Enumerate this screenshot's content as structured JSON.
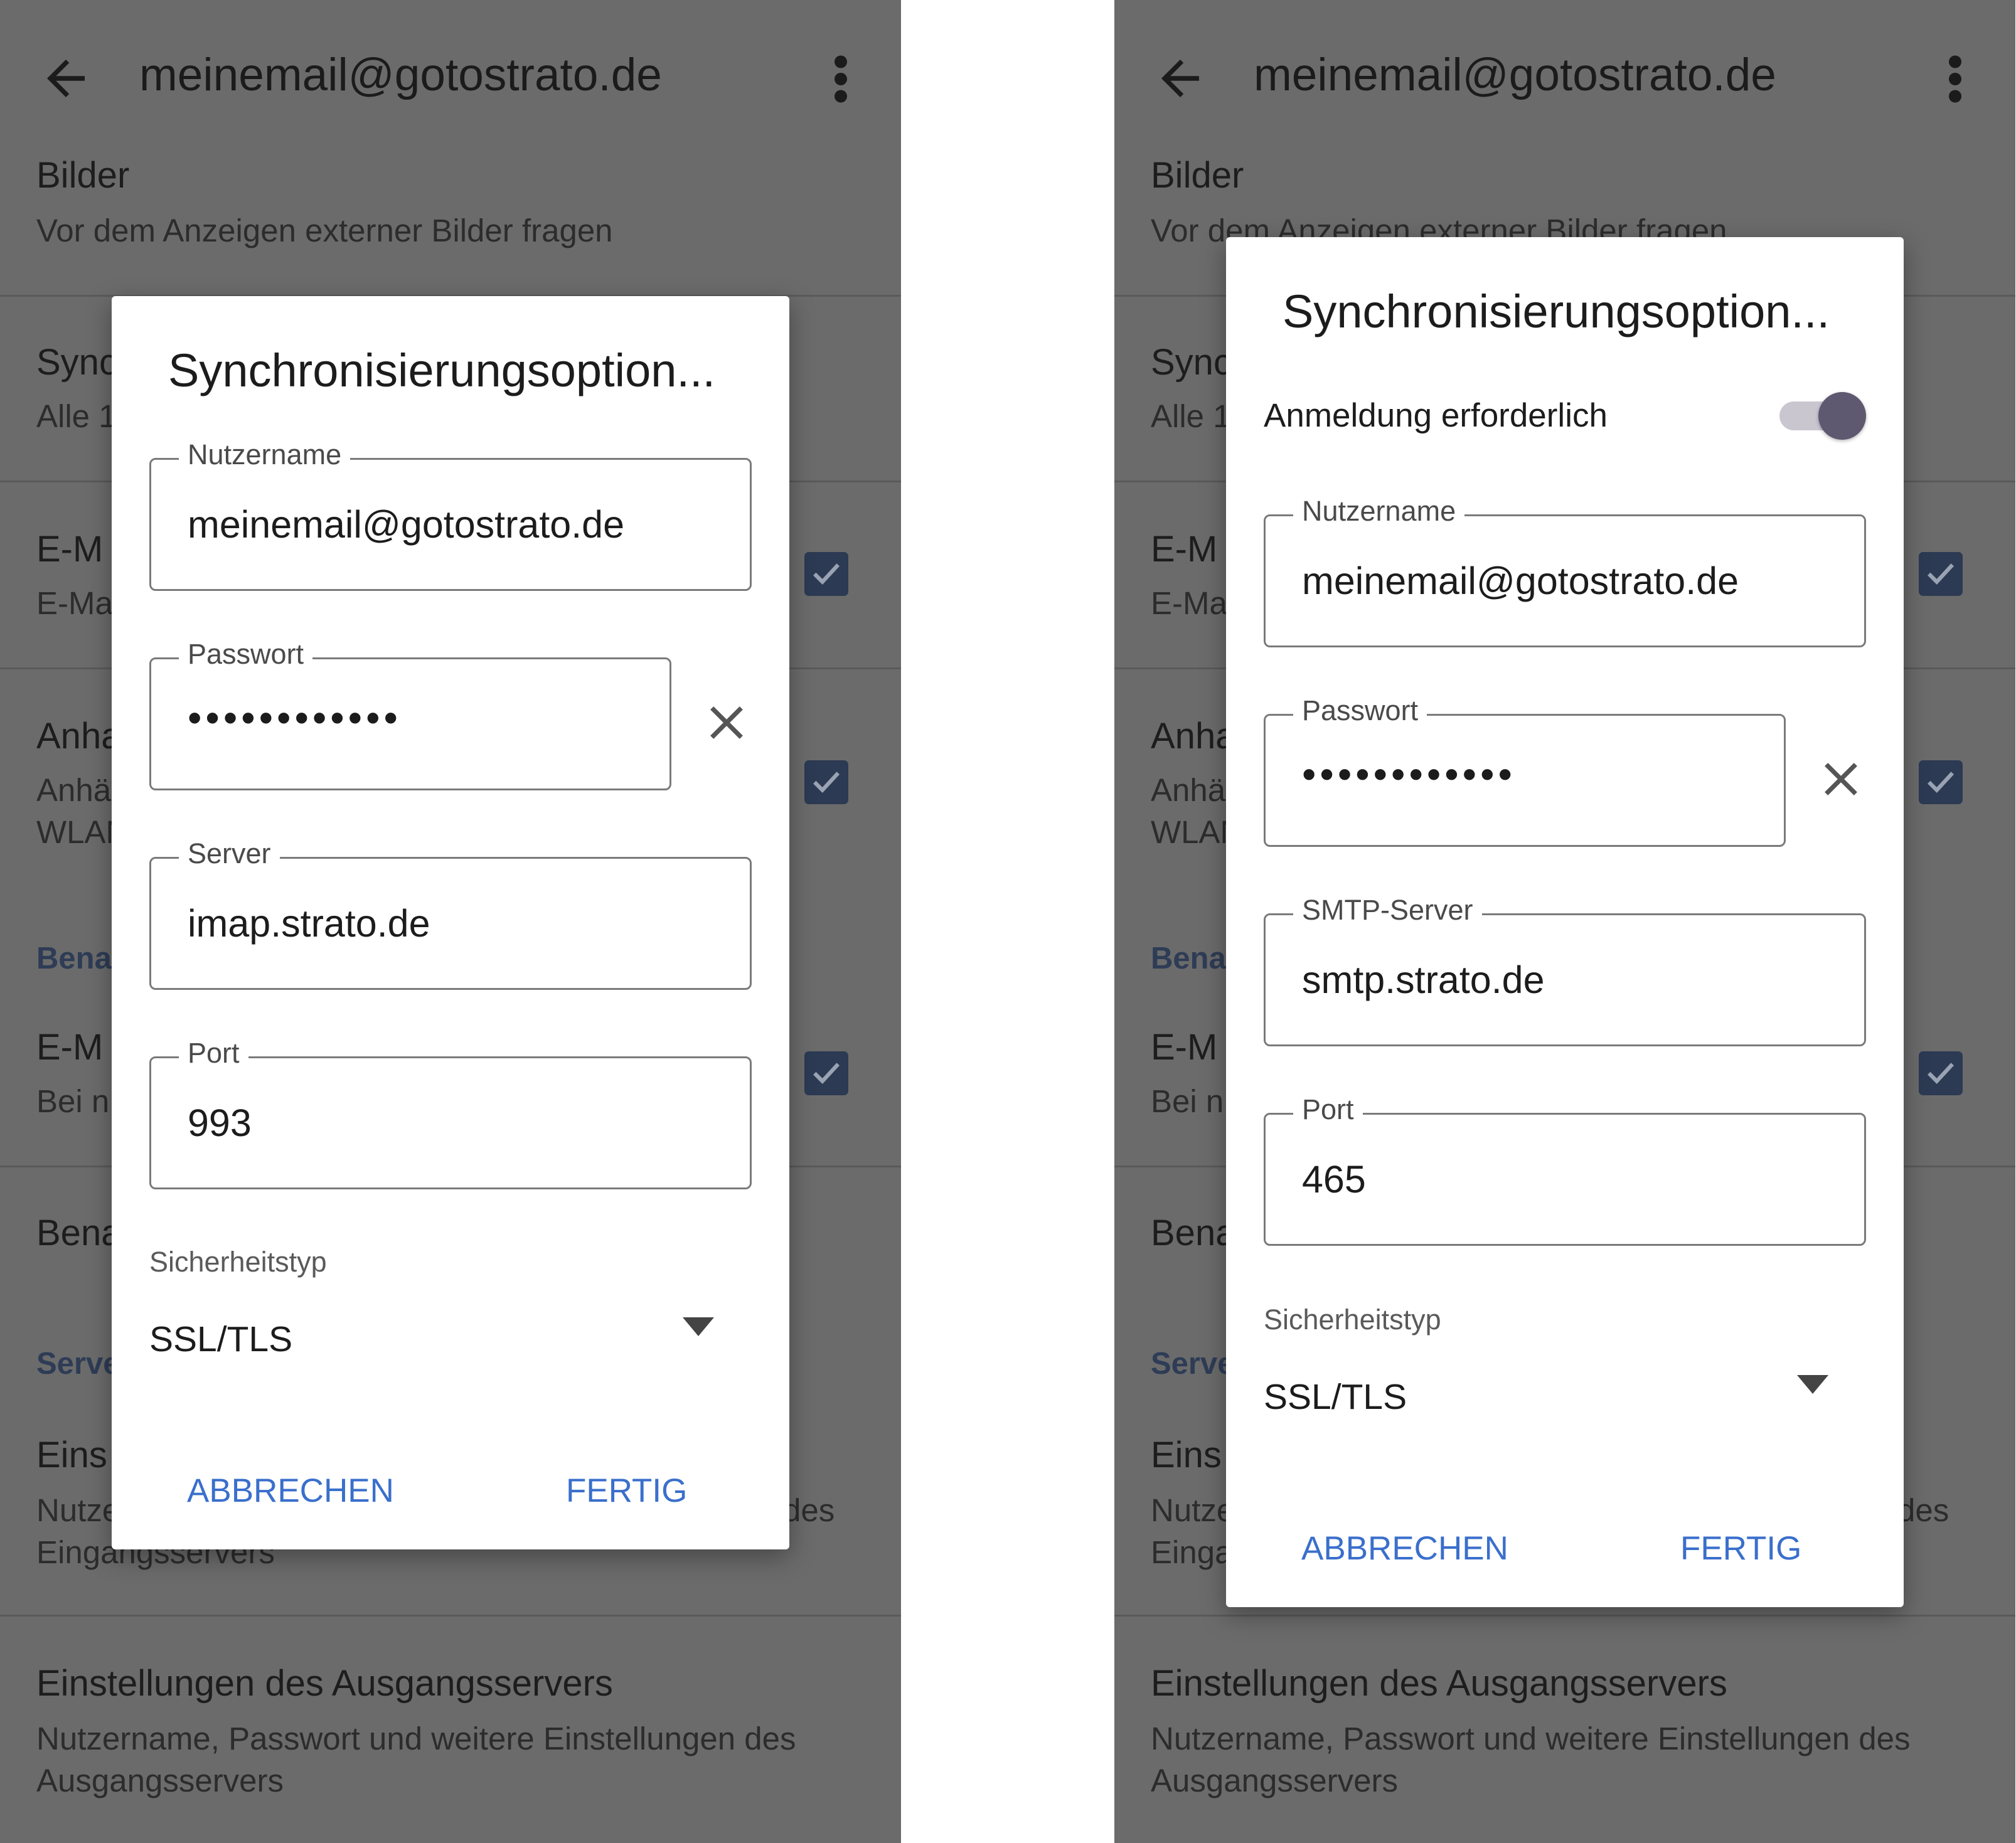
{
  "screens": [
    {
      "appbar": {
        "title": "meinemail@gotostrato.de",
        "back_icon": "arrow-back-icon",
        "more_icon": "more-vert-icon"
      },
      "background": {
        "images": {
          "title": "Bilder",
          "subtitle": "Vor dem Anzeigen externer Bilder fragen"
        },
        "sync": {
          "title": "Sync",
          "subtitle": "Alle 1"
        },
        "email": {
          "title": "E-M",
          "subtitle": "E-Ma"
        },
        "attachments": {
          "title": "Anha",
          "subtitle_1": "Anhä",
          "subtitle_2": "WLAN"
        },
        "notifications_header": "Bena",
        "email_notif": {
          "title": "E-M",
          "subtitle": "Bei n"
        },
        "notif_settings": {
          "title": "Bena"
        },
        "server_header": "Serve",
        "incoming": {
          "title": "Eins",
          "subtitle_1": "Nutze",
          "subtitle_1_end": "des",
          "subtitle_2": "Eingangsservers"
        },
        "outgoing": {
          "title": "Einstellungen des Ausgangsservers",
          "subtitle_1": "Nutzername, Passwort und weitere Einstellungen des",
          "subtitle_2": "Ausgangsservers"
        }
      },
      "dialog": {
        "title": "Synchronisierungsoption...",
        "username": {
          "label": "Nutzername",
          "value": "meinemail@gotostrato.de"
        },
        "password": {
          "label": "Passwort",
          "value": "••••••••••••"
        },
        "server": {
          "label": "Server",
          "value": "imap.strato.de"
        },
        "port": {
          "label": "Port",
          "value": "993"
        },
        "security": {
          "label": "Sicherheitstyp",
          "value": "SSL/TLS"
        },
        "cancel_label": "ABBRECHEN",
        "done_label": "FERTIG"
      }
    },
    {
      "appbar": {
        "title": "meinemail@gotostrato.de",
        "back_icon": "arrow-back-icon",
        "more_icon": "more-vert-icon"
      },
      "background": {
        "images": {
          "title": "Bilder",
          "subtitle": "Vor dem Anzeigen externer Bilder fragen"
        },
        "sync": {
          "title": "Sync",
          "subtitle": "Alle 1"
        },
        "email": {
          "title": "E-M",
          "subtitle": "E-Ma"
        },
        "attachments": {
          "title": "Anha",
          "subtitle_1": "Anhä",
          "subtitle_2": "WLAN"
        },
        "notifications_header": "Bena",
        "email_notif": {
          "title": "E-M",
          "subtitle": "Bei n"
        },
        "notif_settings": {
          "title": "Bena"
        },
        "server_header": "Serve",
        "incoming": {
          "title": "Eins",
          "subtitle_1": "Nutze",
          "subtitle_1_end": "des",
          "subtitle_2": "Einga"
        },
        "outgoing": {
          "title": "Einstellungen des Ausgangsservers",
          "subtitle_1": "Nutzername, Passwort und weitere Einstellungen des",
          "subtitle_2": "Ausgangsservers"
        }
      },
      "dialog": {
        "title": "Synchronisierungsoption...",
        "login_required": {
          "label": "Anmeldung erforderlich",
          "enabled": true
        },
        "username": {
          "label": "Nutzername",
          "value": "meinemail@gotostrato.de"
        },
        "password": {
          "label": "Passwort",
          "value": "••••••••••••"
        },
        "server": {
          "label": "SMTP-Server",
          "value": "smtp.strato.de"
        },
        "port": {
          "label": "Port",
          "value": "465"
        },
        "security": {
          "label": "Sicherheitstyp",
          "value": "SSL/TLS"
        },
        "cancel_label": "ABBRECHEN",
        "done_label": "FERTIG"
      }
    }
  ],
  "colors": {
    "scrim": "#6b6b6b",
    "accent": "#3a6fcc",
    "checkbox": "#2c3a53",
    "toggle_thumb": "#5e5870"
  }
}
